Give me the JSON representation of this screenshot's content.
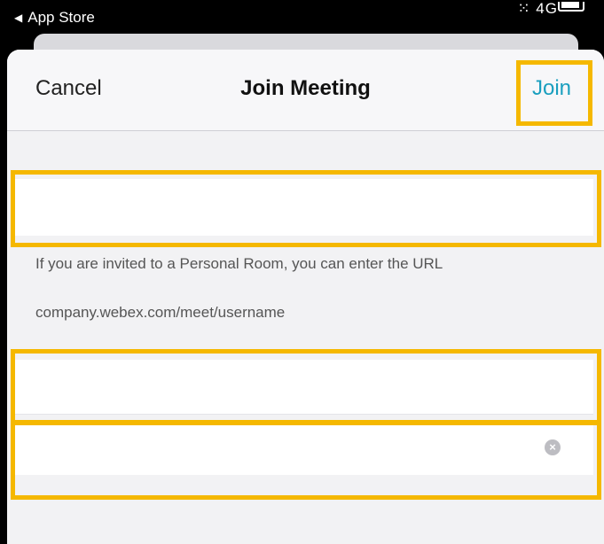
{
  "status_bar": {
    "back_app_label": "App Store",
    "back_arrow": "◀",
    "signal_text": "⁙ 4G",
    "battery_icon": "battery-icon"
  },
  "nav": {
    "cancel_label": "Cancel",
    "title": "Join Meeting",
    "join_label": "Join"
  },
  "form": {
    "meeting_field_value": "",
    "hint_line1": "If you are invited to a Personal Room, you can enter the URL",
    "hint_line2": "company.webex.com/meet/username",
    "name_field_value": "",
    "email_field_value": "",
    "clear_icon_glyph": "×"
  },
  "colors": {
    "accent": "#1a9fbf",
    "highlight": "#f5b800",
    "sheet_bg": "#f2f2f4"
  }
}
